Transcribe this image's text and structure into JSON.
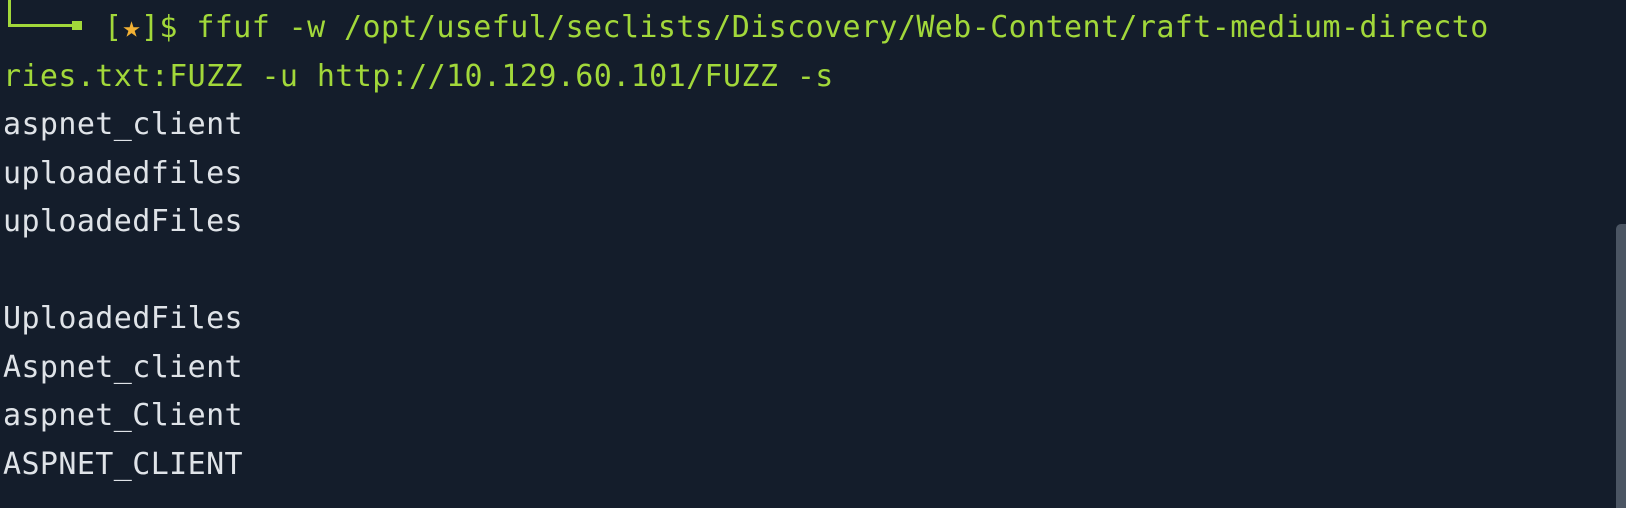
{
  "terminal": {
    "prompt": {
      "open_bracket": "[",
      "star": "★",
      "close_bracket": "]$",
      "command": "ffuf -w /opt/useful/seclists/Discovery/Web-Content/raft-medium-directo",
      "command_wrap": "ries.txt:FUZZ -u http://10.129.60.101/FUZZ -s"
    },
    "output": [
      "aspnet_client",
      "uploadedfiles",
      "uploadedFiles",
      "",
      "UploadedFiles",
      "Aspnet_client",
      "aspnet_Client",
      "ASPNET_CLIENT"
    ]
  },
  "colors": {
    "background": "#141d2b",
    "prompt_green": "#a2d83a",
    "star_orange": "#f2b134",
    "text": "#dfe3e8",
    "scrollbar": "#4b5563"
  }
}
